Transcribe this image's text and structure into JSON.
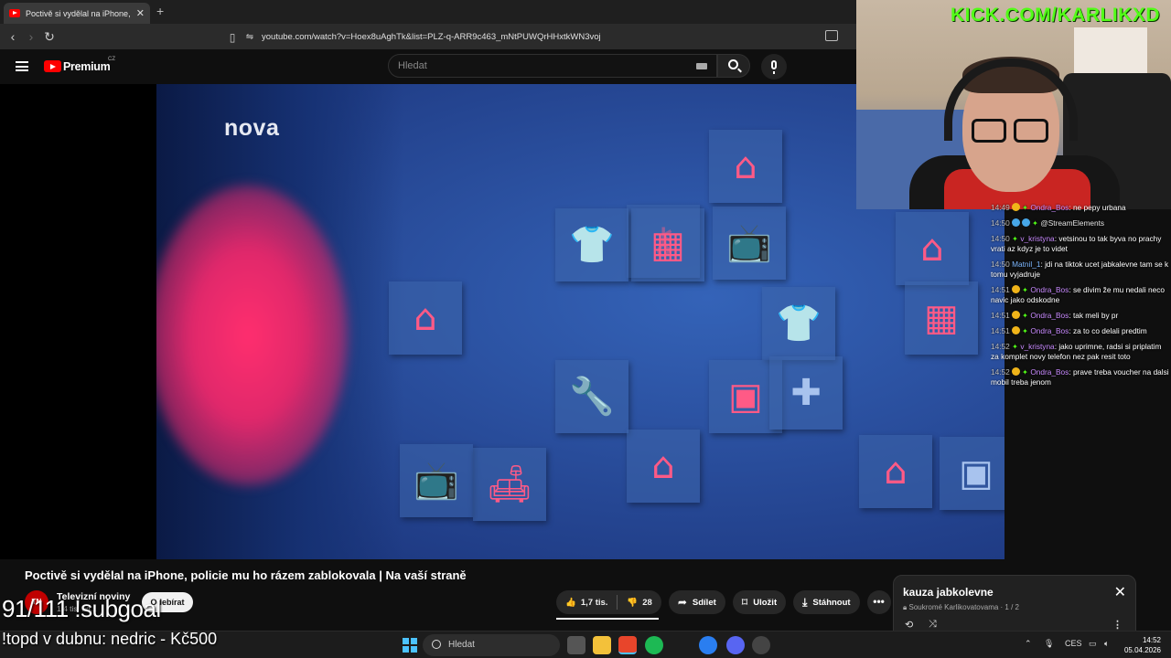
{
  "browser": {
    "tab_title": "Poctivě si vydělal na iPhone, poli",
    "tab_close": "✕",
    "new_tab": "+",
    "url": "youtube.com/watch?v=Hoex8uAghTk&list=PLZ-q-ARR9c463_mNtPUWQrHHxtkWN3voj"
  },
  "youtube": {
    "brand": "Premium",
    "brand_cc": "CZ",
    "search_placeholder": "Hledat"
  },
  "video": {
    "logo": "nova",
    "title": "Poctivě si vydělal na iPhone, policie mu ho rázem zablokovala | Na vaší straně",
    "channel_name": "Televizní noviny",
    "channel_sub": "1,4 tis. od...",
    "channel_avatar_text": "TN",
    "subscribe_label": "Odebírat",
    "likes": "1,7 tis.",
    "dislikes": "28",
    "share_label": "Sdílet",
    "save_label": "Uložit",
    "download_label": "Stáhnout",
    "more_label": "•••"
  },
  "playlist": {
    "title": "kauza jabkolevne",
    "meta": "Soukromé Karlikovatovama · 1 / 2",
    "close": "✕"
  },
  "stream": {
    "kick_url": "KICK.COM/KARLIKXD",
    "subgoal": "91/111 !subgoal",
    "topd": "!topd v dubnu: nedric - Kč500"
  },
  "chat": [
    {
      "ts": "14:49",
      "badges": [
        "gold",
        "green"
      ],
      "user": "Ondra_Bos",
      "ucls": "",
      "msg": "ne pepy urbana"
    },
    {
      "ts": "14:50",
      "badges": [
        "blue",
        "blue",
        "green"
      ],
      "user": "@StreamElements",
      "ucls": "grn",
      "msg": ""
    },
    {
      "ts": "14:50",
      "badges": [
        "green"
      ],
      "user": "v_kristyna",
      "ucls": "",
      "msg": "vetsinou to tak byva no prachy vrati az kdyz je to videt"
    },
    {
      "ts": "14:50",
      "badges": [],
      "user": "Matnil_1",
      "ucls": "alt",
      "msg": "jdi na tiktok ucet jabkalevne tam se k tomu vyjadruje"
    },
    {
      "ts": "14:51",
      "badges": [
        "gold",
        "green"
      ],
      "user": "Ondra_Bos",
      "ucls": "",
      "msg": "se divim že mu nedali neco navic jako odskodne"
    },
    {
      "ts": "14:51",
      "badges": [
        "gold",
        "green"
      ],
      "user": "Ondra_Bos",
      "ucls": "",
      "msg": "tak meli by pr"
    },
    {
      "ts": "14:51",
      "badges": [
        "gold",
        "green"
      ],
      "user": "Ondra_Bos",
      "ucls": "",
      "msg": "za to co delali predtim"
    },
    {
      "ts": "14:52",
      "badges": [
        "green"
      ],
      "user": "v_kristyna",
      "ucls": "",
      "msg": "jako uprimne, radsi si priplatim za komplet novy telefon nez pak resit toto"
    },
    {
      "ts": "14:52",
      "badges": [
        "gold",
        "green"
      ],
      "user": "Ondra_Bos",
      "ucls": "",
      "msg": "prave treba voucher na dalsi mobil treba jenom"
    }
  ],
  "taskbar": {
    "search_label": "Hledat",
    "lang": "CES",
    "time": "14:52",
    "date": "05.04.2026"
  },
  "colors": {
    "youtube_red": "#ff0000",
    "kick_green": "#53fc18",
    "icon_pink": "#ff5a86",
    "video_blue": "#2a4f9e"
  }
}
